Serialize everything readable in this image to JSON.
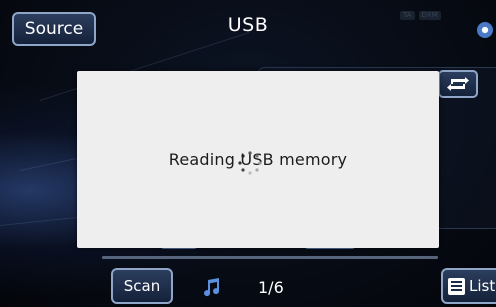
{
  "header": {
    "source_label": "Source",
    "title": "USB",
    "status_indicators": [
      "TA",
      "DXM"
    ]
  },
  "dialog": {
    "message": "Reading USB memory"
  },
  "footer": {
    "scan_label": "Scan",
    "track_counter": "1/6",
    "list_label": "List"
  },
  "icons": {
    "bluetooth": "bluetooth-icon",
    "repeat": "repeat-icon",
    "music_note": "music-note-icon",
    "list": "list-icon",
    "loading": "loading-spinner-icon"
  },
  "colors": {
    "button_border": "#8fa6c8",
    "dialog_bg": "#eeeeef",
    "screen_bg": "#05080f"
  }
}
